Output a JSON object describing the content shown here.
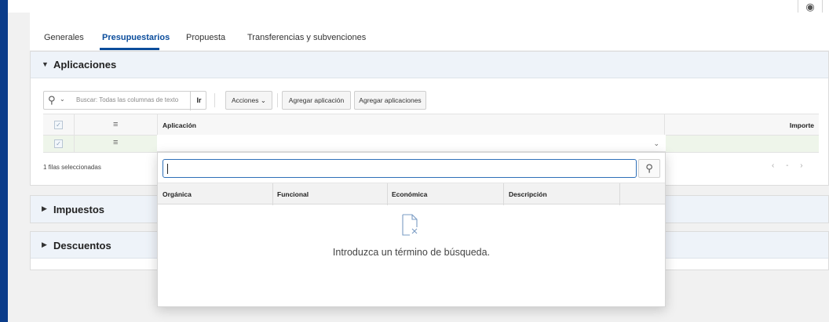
{
  "header": {
    "corner_icon": "eye-icon"
  },
  "tabs": [
    {
      "label": "Generales",
      "active": false
    },
    {
      "label": "Presupuestarios",
      "active": true
    },
    {
      "label": "Propuesta",
      "active": false
    },
    {
      "label": "Transferencias y subvenciones",
      "active": false
    }
  ],
  "regions": {
    "aplicaciones": {
      "title": "Aplicaciones",
      "expanded": true
    },
    "impuestos": {
      "title": "Impuestos",
      "expanded": false
    },
    "descuentos": {
      "title": "Descuentos",
      "expanded": false
    }
  },
  "toolbar": {
    "search_placeholder": "Buscar: Todas las columnas de texto",
    "go_label": "Ir",
    "actions_label": "Acciones",
    "add_one_label": "Agregar aplicación",
    "add_many_label": "Agregar aplicaciones"
  },
  "grid": {
    "columns": [
      "Aplicación",
      "Importe"
    ],
    "footer": "1 filas seleccionadas",
    "pager": "‹ - ›"
  },
  "popup": {
    "search_value": "",
    "columns": [
      "Orgánica",
      "Funcional",
      "Económica",
      "Descripción"
    ],
    "empty_message": "Introduzca un término de búsqueda."
  },
  "colors": {
    "accent": "#0b4d9c",
    "left_bar": "#0b3c8a",
    "selected_row": "#eef5ea",
    "header_bg": "#eef3f9"
  }
}
